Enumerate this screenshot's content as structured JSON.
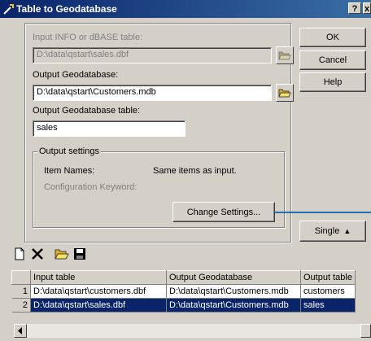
{
  "window": {
    "title": "Table to Geodatabase",
    "help_button": "?",
    "close_button": "x"
  },
  "form": {
    "input_label": "Input INFO or dBASE table:",
    "input_value": "D:\\data\\qstart\\sales.dbf",
    "output_gdb_label": "Output Geodatabase:",
    "output_gdb_value": "D:\\data\\qstart\\Customers.mdb",
    "output_table_label": "Output Geodatabase table:",
    "output_table_value": "sales"
  },
  "settings": {
    "group_title": "Output settings",
    "item_names_label": "Item Names:",
    "item_names_value": "Same items as input.",
    "config_keyword_label": "Configuration Keyword:",
    "change_button": "Change Settings..."
  },
  "buttons": {
    "ok": "OK",
    "cancel": "Cancel",
    "help": "Help",
    "single": "Single"
  },
  "batch": {
    "columns": [
      "Input table",
      "Output Geodatabase",
      "Output table"
    ],
    "rows": [
      {
        "num": "1",
        "input": "D:\\data\\qstart\\customers.dbf",
        "output_gdb": "D:\\data\\qstart\\Customers.mdb",
        "output_table": "customers",
        "selected": false
      },
      {
        "num": "2",
        "input": "D:\\data\\qstart\\sales.dbf",
        "output_gdb": "D:\\data\\qstart\\Customers.mdb",
        "output_table": "sales",
        "selected": true
      }
    ]
  },
  "icons": {
    "title": "wrench-icon",
    "browse": "open-folder-icon",
    "new": "new-document-icon",
    "delete": "delete-x-icon",
    "open": "open-folder-icon",
    "save": "save-disk-icon"
  },
  "colors": {
    "titlebar": "#0a246a",
    "selection": "#0a246a",
    "callout_line": "#1f6fb2"
  }
}
